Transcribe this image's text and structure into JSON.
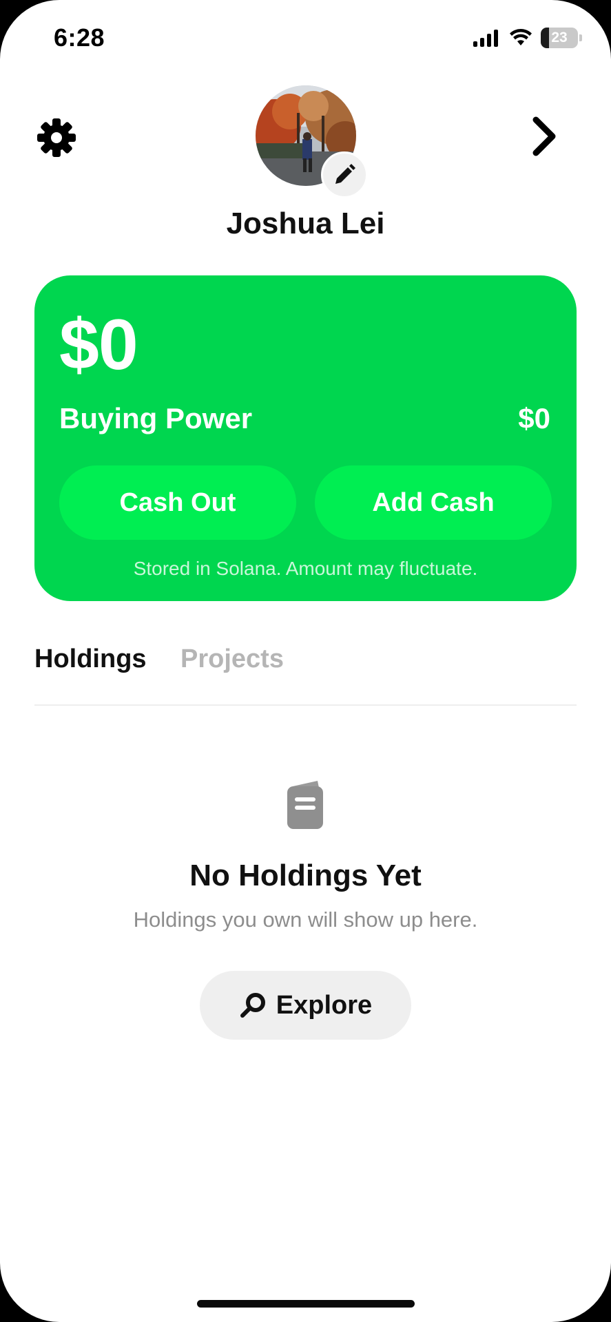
{
  "status_bar": {
    "time": "6:28",
    "battery_level": "23",
    "battery_fraction": 0.23
  },
  "profile": {
    "name": "Joshua Lei"
  },
  "icons": {
    "settings": "gear-icon",
    "forward": "chevron-right-icon",
    "edit": "pencil-icon",
    "empty": "document-icon",
    "search": "search-icon",
    "signal": "signal-icon",
    "wifi": "wifi-icon"
  },
  "card": {
    "balance": "$0",
    "buying_power_label": "Buying Power",
    "buying_power_value": "$0",
    "cash_out_label": "Cash Out",
    "add_cash_label": "Add Cash",
    "note": "Stored in Solana. Amount may fluctuate."
  },
  "tabs": [
    {
      "label": "Holdings",
      "active": true
    },
    {
      "label": "Projects",
      "active": false
    }
  ],
  "empty_state": {
    "title": "No Holdings Yet",
    "subtitle": "Holdings you own will show up here.",
    "button_label": "Explore"
  },
  "colors": {
    "card_green": "#00d64f",
    "pill_green": "#00ee52",
    "text_dark": "#111111",
    "text_muted": "#8d8d8d",
    "tab_inactive": "#b5b5b5"
  }
}
